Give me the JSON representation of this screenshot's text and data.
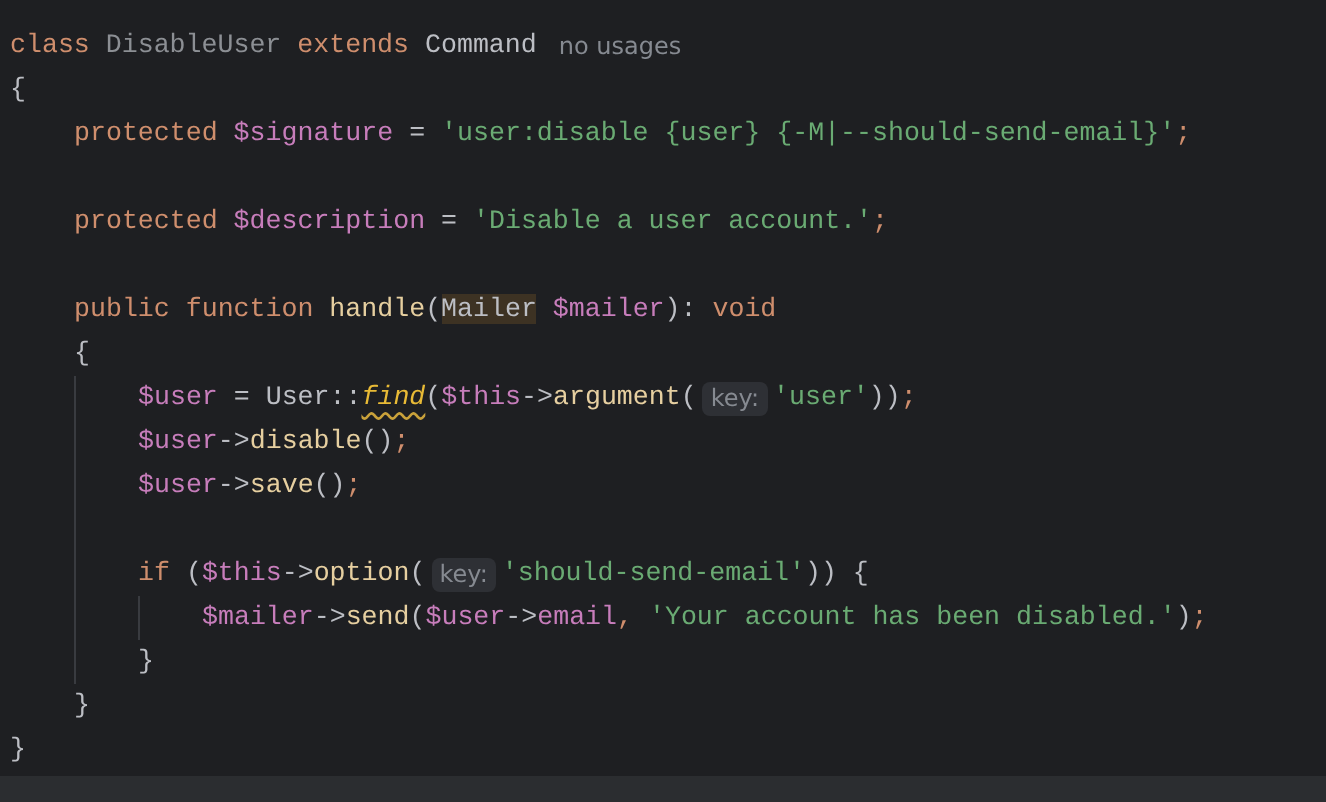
{
  "editor": {
    "lines": [
      {
        "tokens": [
          {
            "text": "class ",
            "kind": "keyword"
          },
          {
            "text": "DisableUser",
            "kind": "unused"
          },
          {
            "text": " extends ",
            "kind": "keyword"
          },
          {
            "text": "Command",
            "kind": "class"
          },
          {
            "text": "no usages",
            "kind": "usages"
          }
        ]
      },
      {
        "tokens": [
          {
            "text": "{",
            "kind": "plain"
          }
        ]
      },
      {
        "children": [
          {
            "tokens": [
              {
                "text": "protected ",
                "kind": "keyword"
              },
              {
                "text": "$signature",
                "kind": "variable"
              },
              {
                "text": " = ",
                "kind": "plain"
              },
              {
                "text": "'user:disable {user} {-M|--should-send-email}'",
                "kind": "string"
              },
              {
                "text": ";",
                "kind": "punct"
              }
            ]
          },
          {
            "blank": true
          },
          {
            "tokens": [
              {
                "text": "protected ",
                "kind": "keyword"
              },
              {
                "text": "$description",
                "kind": "variable"
              },
              {
                "text": " = ",
                "kind": "plain"
              },
              {
                "text": "'Disable a user account.'",
                "kind": "string"
              },
              {
                "text": ";",
                "kind": "punct"
              }
            ]
          },
          {
            "blank": true
          },
          {
            "tokens": [
              {
                "text": "public function ",
                "kind": "keyword"
              },
              {
                "text": "handle",
                "kind": "method"
              },
              {
                "text": "(",
                "kind": "plain"
              },
              {
                "text": "Mailer",
                "kind": "occurrence"
              },
              {
                "text": " $mailer",
                "kind": "variable"
              },
              {
                "text": "): ",
                "kind": "plain"
              },
              {
                "text": "void",
                "kind": "keyword"
              }
            ]
          },
          {
            "tokens": [
              {
                "text": "{",
                "kind": "plain"
              }
            ]
          },
          {
            "children": [
              {
                "tokens": [
                  {
                    "text": "$user",
                    "kind": "variable"
                  },
                  {
                    "text": " = User::",
                    "kind": "plain"
                  },
                  {
                    "text": "find",
                    "kind": "warning"
                  },
                  {
                    "text": "(",
                    "kind": "plain"
                  },
                  {
                    "text": "$this",
                    "kind": "variable"
                  },
                  {
                    "text": "->",
                    "kind": "plain"
                  },
                  {
                    "text": "argument",
                    "kind": "method"
                  },
                  {
                    "text": "(",
                    "kind": "plain"
                  },
                  {
                    "text": "key:",
                    "kind": "hint"
                  },
                  {
                    "text": "'user'",
                    "kind": "string"
                  },
                  {
                    "text": "))",
                    "kind": "plain"
                  },
                  {
                    "text": ";",
                    "kind": "punct"
                  }
                ]
              },
              {
                "tokens": [
                  {
                    "text": "$user",
                    "kind": "variable"
                  },
                  {
                    "text": "->",
                    "kind": "plain"
                  },
                  {
                    "text": "disable",
                    "kind": "method"
                  },
                  {
                    "text": "()",
                    "kind": "plain"
                  },
                  {
                    "text": ";",
                    "kind": "punct"
                  }
                ]
              },
              {
                "tokens": [
                  {
                    "text": "$user",
                    "kind": "variable"
                  },
                  {
                    "text": "->",
                    "kind": "plain"
                  },
                  {
                    "text": "save",
                    "kind": "method"
                  },
                  {
                    "text": "()",
                    "kind": "plain"
                  },
                  {
                    "text": ";",
                    "kind": "punct"
                  }
                ]
              },
              {
                "blank": true
              },
              {
                "tokens": [
                  {
                    "text": "if ",
                    "kind": "keyword"
                  },
                  {
                    "text": "(",
                    "kind": "plain"
                  },
                  {
                    "text": "$this",
                    "kind": "variable"
                  },
                  {
                    "text": "->",
                    "kind": "plain"
                  },
                  {
                    "text": "option",
                    "kind": "method"
                  },
                  {
                    "text": "(",
                    "kind": "plain"
                  },
                  {
                    "text": "key:",
                    "kind": "hint"
                  },
                  {
                    "text": "'should-send-email'",
                    "kind": "string"
                  },
                  {
                    "text": ")) {",
                    "kind": "plain"
                  }
                ]
              },
              {
                "children": [
                  {
                    "tokens": [
                      {
                        "text": "$mailer",
                        "kind": "variable"
                      },
                      {
                        "text": "->",
                        "kind": "plain"
                      },
                      {
                        "text": "send",
                        "kind": "method"
                      },
                      {
                        "text": "(",
                        "kind": "plain"
                      },
                      {
                        "text": "$user",
                        "kind": "variable"
                      },
                      {
                        "text": "->",
                        "kind": "plain"
                      },
                      {
                        "text": "email",
                        "kind": "variable"
                      },
                      {
                        "text": ", ",
                        "kind": "punct"
                      },
                      {
                        "text": "'Your account has been disabled.'",
                        "kind": "string"
                      },
                      {
                        "text": ")",
                        "kind": "plain"
                      },
                      {
                        "text": ";",
                        "kind": "punct"
                      }
                    ]
                  }
                ]
              },
              {
                "tokens": [
                  {
                    "text": "}",
                    "kind": "plain"
                  }
                ]
              }
            ]
          },
          {
            "tokens": [
              {
                "text": "}",
                "kind": "plain"
              }
            ]
          }
        ]
      },
      {
        "tokens": [
          {
            "text": "}",
            "kind": "plain"
          }
        ]
      }
    ]
  }
}
